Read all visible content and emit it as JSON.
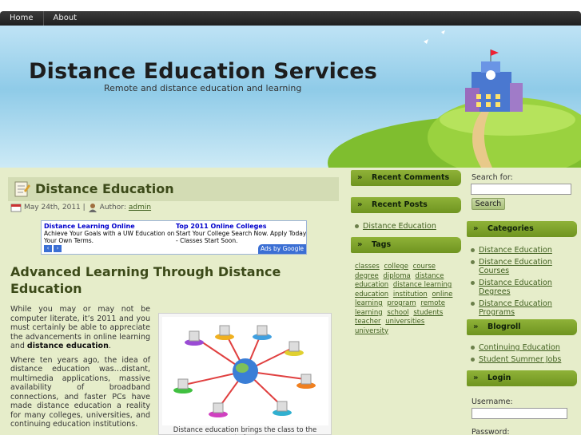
{
  "nav": {
    "items": [
      "Home",
      "About"
    ]
  },
  "header": {
    "title": "Distance Education Services",
    "tagline": "Remote and distance education and learning"
  },
  "post": {
    "title": "Distance Education",
    "date": "May 24th, 2011 |",
    "author_label": "Author:",
    "author": "admin",
    "heading": "Advanced Learning Through Distance Education",
    "para1_a": "While you may or may not be computer literate, it’s 2011 and you must certainly be able to appreciate the advancements in online learning and ",
    "para1_bold": "distance education",
    "para1_end": ".",
    "para2": "Where ten years ago, the idea of distance education was…distant, multimedia applications, massive availability of broadband connections, and faster PCs have made distance education a reality for many colleges, universities, and continuing education institutions.",
    "figure_caption": "Distance education brings the class to the student."
  },
  "ads": {
    "ad1_title": "Distance Learning Online",
    "ad1_text": "Achieve Your Goals with a UW Education on Your Own Terms.",
    "ad2_title": "Top 2011 Online Colleges",
    "ad2_text": "Start Your College Search Now. Apply Today - Classes Start Soon.",
    "prev": "‹",
    "next": "›",
    "ads_by": "Ads by Google"
  },
  "sidebar_left": {
    "recent_comments": "Recent Comments",
    "recent_posts": "Recent Posts",
    "posts": [
      "Distance Education"
    ],
    "tags_title": "Tags",
    "tags": [
      "classes",
      "college",
      "course",
      "degree",
      "diploma",
      "distance education",
      "distance learning",
      "education",
      "institution",
      "online learning",
      "program",
      "remote learning",
      "school",
      "students",
      "teacher",
      "universities",
      "university"
    ]
  },
  "sidebar_right": {
    "search_label": "Search for:",
    "search_button": "Search",
    "categories_title": "Categories",
    "categories": [
      "Distance Education",
      "Distance Education Courses",
      "Distance Education Degrees",
      "Distance Education Programs"
    ],
    "blogroll_title": "Blogroll",
    "blogroll": [
      "Continuing Education",
      "Student Summer Jobs"
    ],
    "login_title": "Login",
    "username_label": "Username:",
    "password_label": "Password:"
  }
}
